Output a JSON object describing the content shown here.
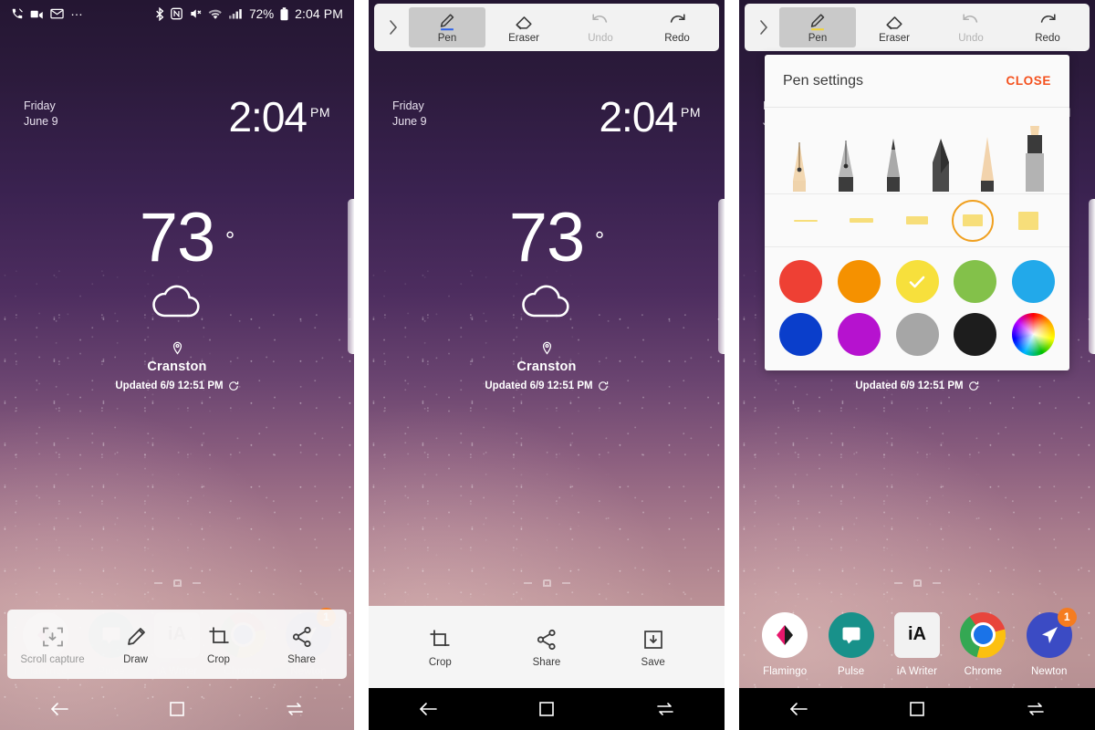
{
  "status_bar": {
    "left_icons": [
      "missed-call-icon",
      "voicemail-icon",
      "mail-icon"
    ],
    "overflow": "…",
    "right_icons": [
      "bluetooth-icon",
      "nfc-icon",
      "mute-icon",
      "wifi-icon",
      "signal-icon"
    ],
    "battery_percent": "72%",
    "time": "2:04 PM"
  },
  "lockclock": {
    "weekday": "Friday",
    "date": "June 9",
    "time": "2:04",
    "ampm": "PM"
  },
  "weather": {
    "temperature": "73",
    "degree": "°",
    "condition_icon": "cloud-icon",
    "location_icon": "location-pin-icon",
    "city": "Cranston",
    "updated": "Updated 6/9 12:51 PM",
    "refresh_icon": "refresh-icon"
  },
  "dock": {
    "apps": [
      {
        "name": "Flamingo",
        "icon": "flamingo-icon",
        "badge": ""
      },
      {
        "name": "Pulse",
        "icon": "pulse-icon",
        "badge": ""
      },
      {
        "name": "iA Writer",
        "icon": "ia-writer-icon",
        "label_glyph": "iA",
        "badge": ""
      },
      {
        "name": "Chrome",
        "icon": "chrome-icon",
        "badge": ""
      },
      {
        "name": "Newton",
        "icon": "newton-icon",
        "badge": "1"
      }
    ]
  },
  "navbar": {
    "back": "back-icon",
    "home": "home-icon",
    "recents": "recents-icon"
  },
  "screenshot_toolbar": {
    "items": [
      {
        "label": "Scroll capture",
        "icon": "scroll-capture-icon",
        "enabled": false
      },
      {
        "label": "Draw",
        "icon": "pencil-draw-icon",
        "enabled": true
      },
      {
        "label": "Crop",
        "icon": "crop-icon",
        "enabled": true
      },
      {
        "label": "Share",
        "icon": "share-icon",
        "enabled": true
      }
    ]
  },
  "edit_toolbar": {
    "items": [
      {
        "label": "Crop",
        "icon": "crop-icon"
      },
      {
        "label": "Share",
        "icon": "share-icon"
      },
      {
        "label": "Save",
        "icon": "save-download-icon"
      }
    ]
  },
  "pen_toolbar": {
    "expand_icon": "chevron-right-icon",
    "items": [
      {
        "label": "Pen",
        "icon": "pen-icon",
        "selected": true,
        "disabled": false
      },
      {
        "label": "Eraser",
        "icon": "eraser-icon",
        "selected": false,
        "disabled": false
      },
      {
        "label": "Undo",
        "icon": "undo-icon",
        "selected": false,
        "disabled": true
      },
      {
        "label": "Redo",
        "icon": "redo-icon",
        "selected": false,
        "disabled": false
      }
    ]
  },
  "pen_settings": {
    "title": "Pen settings",
    "close_label": "CLOSE",
    "pen_types": [
      {
        "name": "fountain-pen",
        "selected": false
      },
      {
        "name": "calligraphy-pen",
        "selected": false
      },
      {
        "name": "mechanical-pencil",
        "selected": false
      },
      {
        "name": "pencil",
        "selected": false
      },
      {
        "name": "marker-pen",
        "selected": false
      },
      {
        "name": "highlighter",
        "selected": true
      }
    ],
    "thickness_options": [
      {
        "size": 1,
        "selected": false
      },
      {
        "size": 2,
        "selected": false
      },
      {
        "size": 3,
        "selected": false
      },
      {
        "size": 4,
        "selected": true
      },
      {
        "size": 5,
        "selected": false
      }
    ],
    "colors_row1": [
      {
        "name": "red",
        "hex": "#ee4034",
        "selected": false
      },
      {
        "name": "orange",
        "hex": "#f59100",
        "selected": false
      },
      {
        "name": "yellow",
        "hex": "#f7e03c",
        "selected": true
      },
      {
        "name": "green",
        "hex": "#83c14a",
        "selected": false
      },
      {
        "name": "light-blue",
        "hex": "#22a9ea",
        "selected": false
      }
    ],
    "colors_row2": [
      {
        "name": "blue",
        "hex": "#0a3ecb",
        "selected": false
      },
      {
        "name": "magenta",
        "hex": "#b612cf",
        "selected": false
      },
      {
        "name": "gray",
        "hex": "#a6a6a6",
        "selected": false
      },
      {
        "name": "black",
        "hex": "#1d1d1d",
        "selected": false
      },
      {
        "name": "color-picker",
        "hex": "rainbow",
        "selected": false
      }
    ],
    "accent_color": "#f4511e",
    "selection_ring_color": "#f0a020"
  }
}
